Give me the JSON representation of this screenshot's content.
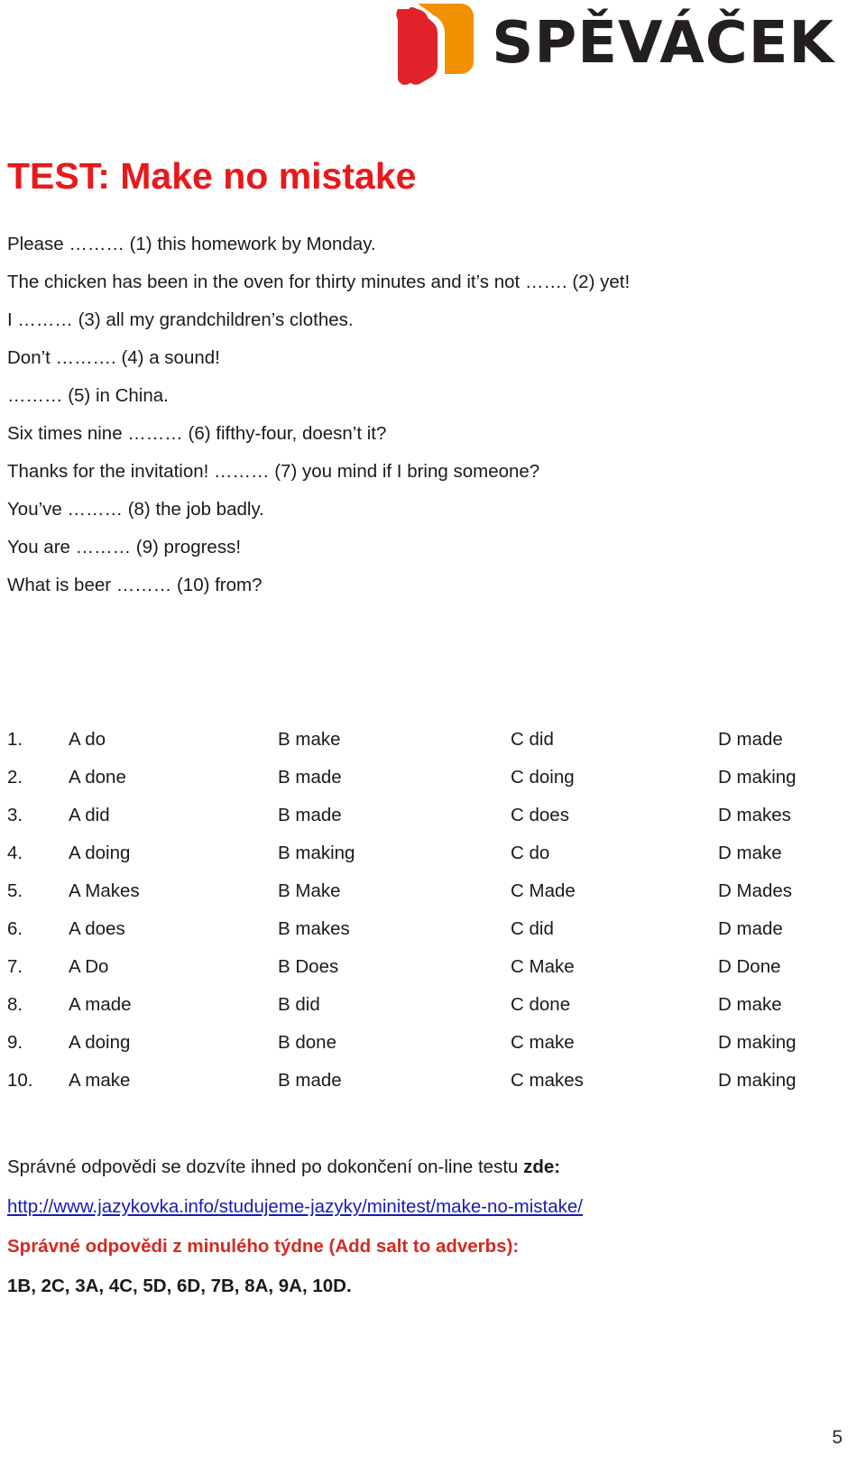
{
  "header": {
    "logo_icon": "book-logo-icon",
    "brand": "SPĚVÁČEK",
    "brand_colors": {
      "red": "#e1222a",
      "orange": "#f29100",
      "text": "#231f20"
    }
  },
  "title": "TEST: Make no mistake",
  "title_color": "#e8191b",
  "sentences": [
    "Please ……… (1) this homework by Monday.",
    "The chicken has been in the oven for thirty minutes and it’s not ……. (2) yet!",
    "I ……… (3) all my grandchildren’s clothes.",
    "Don’t ………. (4) a sound!",
    "……… (5) in China.",
    "Six times nine ……… (6) fifthy-four, doesn’t it?",
    "Thanks for the invitation! ……… (7) you mind if I bring someone?",
    "You’ve ……… (8) the job badly.",
    "You are ……… (9) progress!",
    "What is beer ……… (10) from?"
  ],
  "options": {
    "rows": [
      {
        "num": "1.",
        "a": "A do",
        "b": "B make",
        "c": "C did",
        "d": "D made"
      },
      {
        "num": "2.",
        "a": "A done",
        "b": "B made",
        "c": "C doing",
        "d": "D making"
      },
      {
        "num": "3.",
        "a": "A did",
        "b": "B made",
        "c": "C does",
        "d": "D makes"
      },
      {
        "num": "4.",
        "a": "A doing",
        "b": "B making",
        "c": "C do",
        "d": "D make"
      },
      {
        "num": "5.",
        "a": "A Makes",
        "b": "B Make",
        "c": "C Made",
        "d": "D Mades"
      },
      {
        "num": "6.",
        "a": "A does",
        "b": "B makes",
        "c": "C did",
        "d": "D made"
      },
      {
        "num": "7.",
        "a": "A Do",
        "b": "B Does",
        "c": "C Make",
        "d": "D Done"
      },
      {
        "num": "8.",
        "a": "A made",
        "b": "B did",
        "c": "C done",
        "d": "D make"
      },
      {
        "num": "9.",
        "a": "A doing",
        "b": "B done",
        "c": "C make",
        "d": "D making"
      },
      {
        "num": "10.",
        "a": "A make",
        "b": "B made",
        "c": "C makes",
        "d": "D making"
      }
    ]
  },
  "footer": {
    "info_text": "Správné odpovědi se dozvíte ihned po dokončení on-line testu ",
    "info_bold": "zde:",
    "link_text": "http://www.jazykovka.info/studujeme-jazyky/minitest/make-no-mistake/",
    "link_color": "#1a1ab8",
    "previous_heading": "Správné odpovědi z minulého týdne (Add salt to adverbs):",
    "previous_heading_color": "#d42a22",
    "previous_answers": "1B, 2C, 3A, 4C, 5D, 6D, 7B, 8A, 9A, 10D."
  },
  "page_number": "5"
}
